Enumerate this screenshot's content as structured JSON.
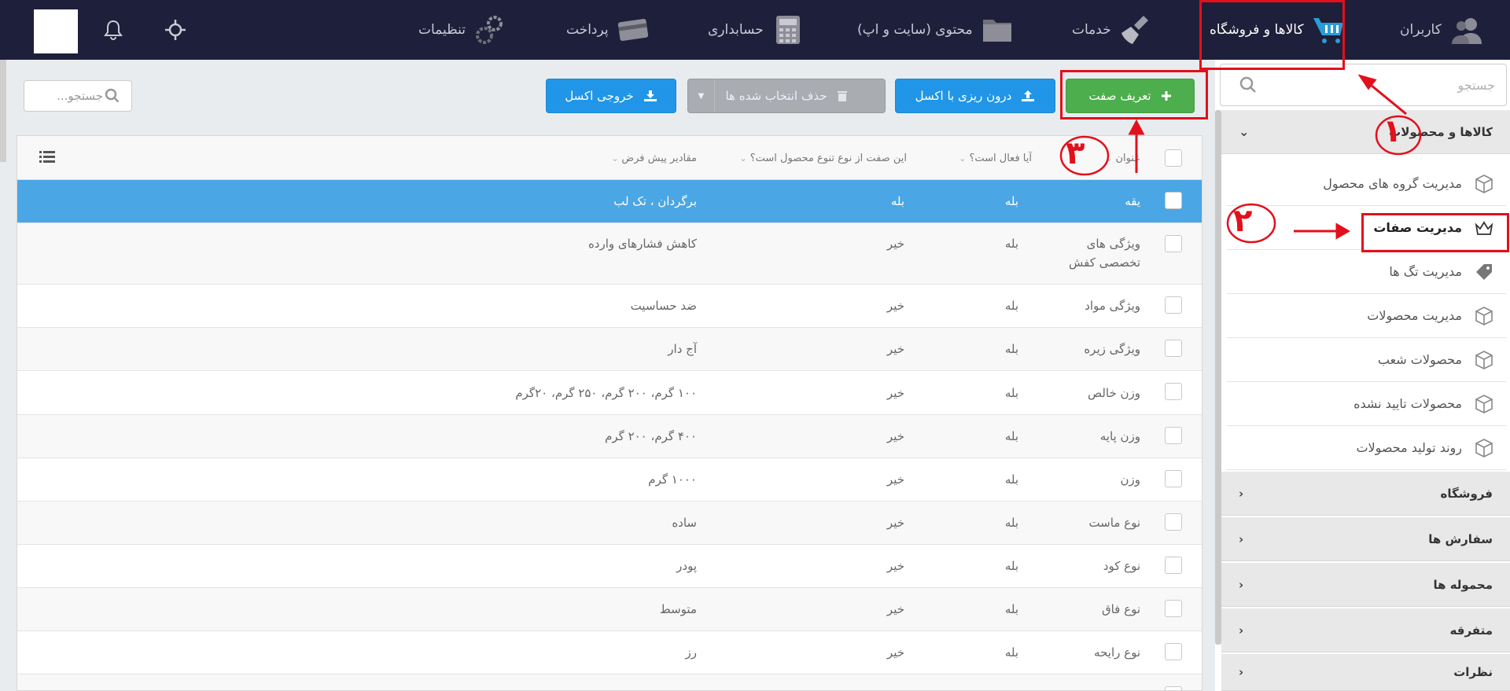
{
  "topnav": {
    "items": [
      {
        "label": "کاربران",
        "icon": "users-icon"
      },
      {
        "label": "کالاها و فروشگاه",
        "icon": "shopping-cart-icon"
      },
      {
        "label": "خدمات",
        "icon": "broom-icon"
      },
      {
        "label": "محتوی (سایت و اپ)",
        "icon": "folder-icon"
      },
      {
        "label": "حسابداری",
        "icon": "calculator-icon"
      },
      {
        "label": "پرداخت",
        "icon": "credit-card-icon"
      },
      {
        "label": "تنظیمات",
        "icon": "gears-icon"
      }
    ],
    "active_index": 1,
    "right_icons": [
      "crosshair-icon",
      "bell-icon"
    ]
  },
  "sidebar": {
    "search_placeholder": "جستجو",
    "open_section": "کالاها و محصولات",
    "items": [
      {
        "label": "مدیریت گروه های محصول",
        "icon": "box-icon"
      },
      {
        "label": "مدیریت صفات",
        "icon": "crown-icon",
        "active": true
      },
      {
        "label": "مدیریت تگ ها",
        "icon": "tag-icon"
      },
      {
        "label": "مدیریت محصولات",
        "icon": "box-icon"
      },
      {
        "label": "محصولات شعب",
        "icon": "box-icon"
      },
      {
        "label": "محصولات تایید نشده",
        "icon": "box-icon"
      },
      {
        "label": "روند تولید محصولات",
        "icon": "box-icon"
      }
    ],
    "sections": [
      "فروشگاه",
      "سفارش ها",
      "محموله ها",
      "متفرقه",
      "نظرات"
    ]
  },
  "toolbar": {
    "define_label": "تعریف صفت",
    "import_label": "درون ریزی با اکسل",
    "delete_label": "حذف انتخاب شده ها",
    "export_label": "خروجی اکسل",
    "search_placeholder": "جستجو..."
  },
  "table": {
    "headers": {
      "title": "عنوان",
      "active": "آیا فعال است؟",
      "variety": "این صفت از نوع تنوع محصول است؟",
      "defaults": "مقادیر پیش فرض"
    },
    "rows": [
      {
        "title": "یقه",
        "active": "بله",
        "variety": "بله",
        "defaults": "برگردان ، تک لب"
      },
      {
        "title": "ویژگی های تخصصی کفش",
        "active": "بله",
        "variety": "خیر",
        "defaults": "کاهش فشارهای وارده"
      },
      {
        "title": "ویژگی مواد",
        "active": "بله",
        "variety": "خیر",
        "defaults": "ضد حساسیت"
      },
      {
        "title": "ویژگی زیره",
        "active": "بله",
        "variety": "خیر",
        "defaults": "آج دار"
      },
      {
        "title": "وزن خالص",
        "active": "بله",
        "variety": "خیر",
        "defaults": "۱۰۰ گرم، ۲۰۰ گرم، ۲۵۰ گرم، ۲۰گرم"
      },
      {
        "title": "وزن پایه",
        "active": "بله",
        "variety": "خیر",
        "defaults": "۴۰۰ گرم، ۲۰۰ گرم"
      },
      {
        "title": "وزن",
        "active": "بله",
        "variety": "خیر",
        "defaults": "۱۰۰۰ گرم"
      },
      {
        "title": "نوع ماست",
        "active": "بله",
        "variety": "خیر",
        "defaults": "ساده"
      },
      {
        "title": "نوع کود",
        "active": "بله",
        "variety": "خیر",
        "defaults": "پودر"
      },
      {
        "title": "نوع فاق",
        "active": "بله",
        "variety": "خیر",
        "defaults": "متوسط"
      },
      {
        "title": "نوع رایحه",
        "active": "بله",
        "variety": "خیر",
        "defaults": "رز"
      }
    ]
  },
  "annotations": {
    "color": "#e3101b",
    "numbers": [
      "۱",
      "۲",
      "۳"
    ]
  }
}
